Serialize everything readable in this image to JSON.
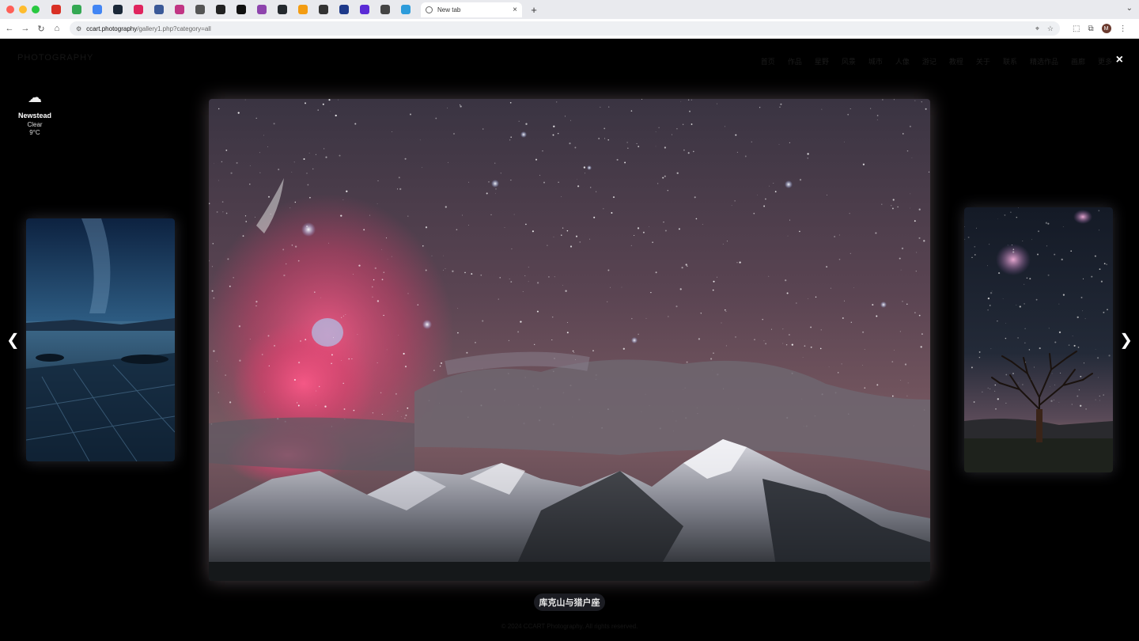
{
  "browser": {
    "pinned_tabs": [
      {
        "icon": "gmail-icon",
        "color": "#d93025"
      },
      {
        "icon": "chrome-icon",
        "color": "#34a853"
      },
      {
        "icon": "drive-icon",
        "color": "#4285f4"
      },
      {
        "icon": "steam-icon",
        "color": "#1b2838"
      },
      {
        "icon": "record-icon",
        "color": "#e0245e"
      },
      {
        "icon": "globe-icon",
        "color": "#3b5998"
      },
      {
        "icon": "instagram-icon",
        "color": "#c13584"
      },
      {
        "icon": "box-icon",
        "color": "#555555"
      },
      {
        "icon": "app-icon",
        "color": "#222222"
      },
      {
        "icon": "notion-icon",
        "color": "#111111"
      },
      {
        "icon": "w-icon",
        "color": "#8e44ad"
      },
      {
        "icon": "github-icon",
        "color": "#24292e"
      },
      {
        "icon": "orange-app-icon",
        "color": "#f39c12"
      },
      {
        "icon": "ball-icon",
        "color": "#333333"
      },
      {
        "icon": "blue-dot-icon",
        "color": "#1e3a8a"
      },
      {
        "icon": "purple-app-icon",
        "color": "#5b2bd6"
      },
      {
        "icon": "chrome-dark-icon",
        "color": "#444444"
      },
      {
        "icon": "screenshot-icon",
        "color": "#2d9cdb"
      }
    ],
    "active_tab": {
      "title": "New tab",
      "close": "×"
    },
    "new_tab": "+",
    "tab_menu": "⌄",
    "nav": {
      "back": "←",
      "forward": "→",
      "reload": "↻",
      "home": "⌂"
    },
    "url_host": "ccart.photography",
    "url_path": "/gallery1.php?category=all",
    "avatar_letter": "M"
  },
  "ghost": {
    "logo": "PHOTOGRAPHY",
    "nav": [
      "首页",
      "作品",
      "星野",
      "风景",
      "城市",
      "人像",
      "游记",
      "教程",
      "关于",
      "联系",
      "精选作品",
      "画廊",
      "更多"
    ],
    "footer": "© 2024 CCART Photography. All rights reserved."
  },
  "lightbox": {
    "close": "×",
    "prev": "❮",
    "next": "❯",
    "caption": "库克山与猎户座"
  },
  "weather": {
    "icon": "cloud-icon",
    "location": "Newstead",
    "condition": "Clear",
    "temperature": "9°C"
  }
}
